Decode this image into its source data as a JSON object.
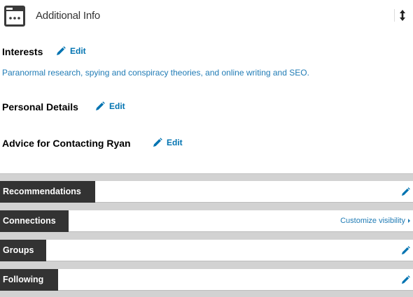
{
  "header": {
    "title": "Additional Info",
    "icon": "folder-dots-icon",
    "sort_icon": "reorder-arrows-icon"
  },
  "sections": {
    "interests": {
      "title": "Interests",
      "edit": "Edit",
      "text": "Paranormal research, spying and conspiracy theories, and online writing and SEO."
    },
    "personal": {
      "title": "Personal Details",
      "edit": "Edit"
    },
    "advice": {
      "title": "Advice for Contacting Ryan",
      "edit": "Edit"
    }
  },
  "rows": {
    "recommendations": {
      "label": "Recommendations",
      "action_icon": "pencil-icon"
    },
    "connections": {
      "label": "Connections",
      "link": "Customize visibility"
    },
    "groups": {
      "label": "Groups",
      "action_icon": "pencil-icon"
    },
    "following": {
      "label": "Following",
      "action_icon": "pencil-icon"
    }
  },
  "colors": {
    "link": "#0073b1",
    "label_bg": "#333333",
    "band_bg": "#d2d2d2"
  }
}
